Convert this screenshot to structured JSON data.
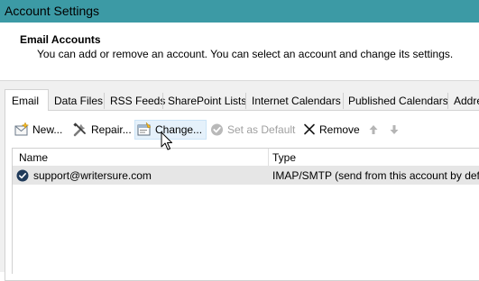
{
  "window": {
    "title": "Account Settings"
  },
  "header": {
    "title": "Email Accounts",
    "description": "You can add or remove an account. You can select an account and change its settings."
  },
  "tabs": [
    {
      "label": "Email",
      "active": true
    },
    {
      "label": "Data Files"
    },
    {
      "label": "RSS Feeds"
    },
    {
      "label": "SharePoint Lists"
    },
    {
      "label": "Internet Calendars"
    },
    {
      "label": "Published Calendars"
    },
    {
      "label": "Addre"
    }
  ],
  "toolbar": {
    "new_label": "New...",
    "repair_label": "Repair...",
    "change_label": "Change...",
    "set_default_label": "Set as Default",
    "remove_label": "Remove"
  },
  "table": {
    "columns": [
      "Name",
      "Type"
    ],
    "rows": [
      {
        "name": "support@writersure.com",
        "type": "IMAP/SMTP (send from this account by defau"
      }
    ]
  },
  "colors": {
    "titlebar": "#3c9aa5",
    "selected_row": "#e6e6e6",
    "default_check": "#1f3a5a"
  }
}
